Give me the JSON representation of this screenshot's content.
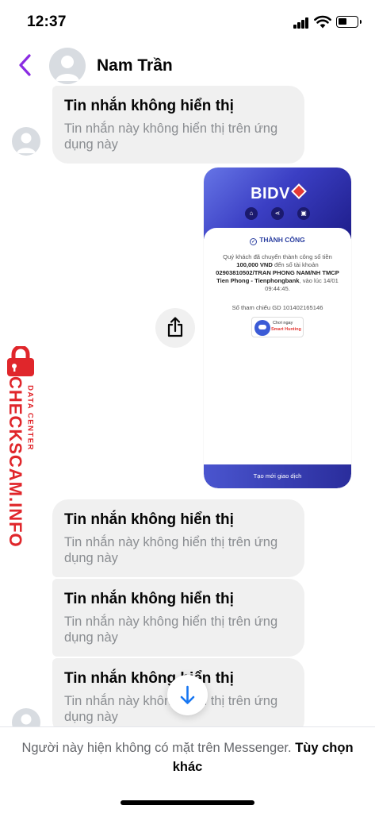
{
  "status_bar": {
    "time": "12:37"
  },
  "header": {
    "contact_name": "Nam Trần"
  },
  "messages": [
    {
      "title": "Tin nhắn không hiển thị",
      "subtitle": "Tin nhắn này không hiển thị trên ứng dụng này"
    },
    {
      "title": "Tin nhắn không hiển thị",
      "subtitle": "Tin nhắn này không hiển thị trên ứng dụng này"
    },
    {
      "title": "Tin nhắn không hiển thị",
      "subtitle": "Tin nhắn này không hiển thị trên ứng dụng này"
    },
    {
      "title": "Tin nhắn không hiển thị",
      "subtitle": "Tin nhắn này không hiển thị trên ứng dụng này"
    }
  ],
  "receipt": {
    "bank": "BIDV",
    "status": "THÀNH CÔNG",
    "text_1": "Quý khách đã chuyển thành công số tiền",
    "amount": "100,000 VND",
    "text_2": "đến số tài khoản",
    "account": "02903810502/TRAN PHONG NAM/NH TMCP Tien Phong - Tienphongbank",
    "text_3": ", vào lúc 14/01 09:44:45.",
    "reference": "Số tham chiếu GD 101402165146",
    "promo_line_1": "Chơi ngay",
    "promo_line_2": "Smart Hunting",
    "button": "Tạo mới giao dịch"
  },
  "watermark": {
    "brand": "CHECKSCAM.INFO",
    "sub": "DATA CENTER"
  },
  "footer": {
    "text": "Người này hiện không có mặt trên Messenger.",
    "link": "Tùy chọn khác"
  },
  "colors": {
    "accent": "#8a2be2",
    "watermark": "#e0262b",
    "bubble": "#f0f0f0"
  },
  "icons": [
    "signal-icon",
    "wifi-icon",
    "battery-icon",
    "back-chevron-icon",
    "share-icon",
    "arrow-down-icon",
    "lock-icon",
    "person-icon"
  ]
}
